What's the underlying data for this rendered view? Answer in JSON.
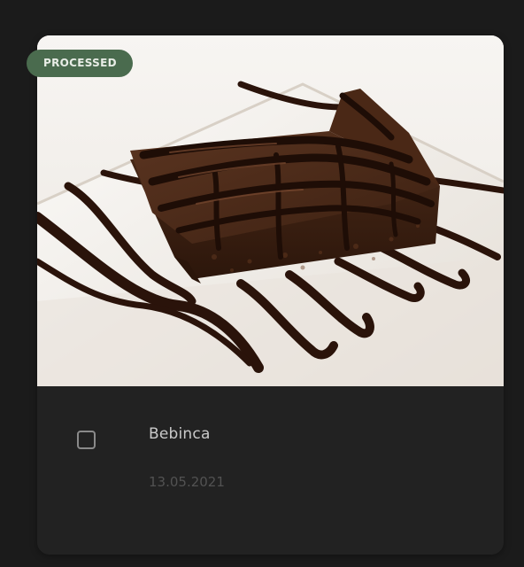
{
  "card": {
    "status_badge": "PROCESSED",
    "title": "Bebinca",
    "date": "13.05.2021",
    "photo_subject": "chocolate brownie with chocolate syrup on white plate",
    "selected": false
  },
  "colors": {
    "page_background": "#1b1b1b",
    "card_background": "#222222",
    "badge_background": "#4a6b4e",
    "title_text": "#c9c9c9",
    "date_text": "#525252"
  }
}
